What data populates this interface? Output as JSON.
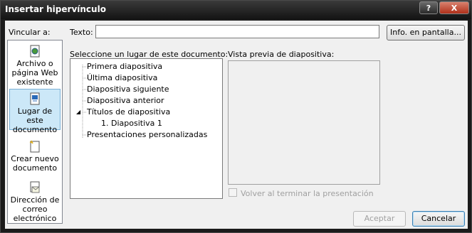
{
  "window": {
    "title": "Insertar hipervínculo",
    "help_btn": "?",
    "close_btn": "X"
  },
  "link_to": {
    "label": "Vincular a:",
    "items": [
      {
        "label": "Archivo o página Web existente",
        "icon": "file-web-icon"
      },
      {
        "label": "Lugar de este documento",
        "icon": "document-place-icon",
        "selected": true
      },
      {
        "label": "Crear nuevo documento",
        "icon": "new-document-icon"
      },
      {
        "label": "Dirección de correo electrónico",
        "icon": "email-icon"
      }
    ]
  },
  "text_field": {
    "label": "Texto:",
    "value": ""
  },
  "screentip_button": "Info. en pantalla...",
  "place_list": {
    "label": "Seleccione un lugar de este documento:",
    "items": [
      "Primera diapositiva",
      "Última diapositiva",
      "Diapositiva siguiente",
      "Diapositiva anterior",
      "Títulos de diapositiva",
      "1. Diapositiva 1",
      "Presentaciones personalizadas"
    ],
    "expander": "◢"
  },
  "preview": {
    "label": "Vista previa de diapositiva:"
  },
  "return_checkbox": {
    "label": "Volver al terminar la presentación",
    "checked": false,
    "enabled": false
  },
  "buttons": {
    "ok": "Aceptar",
    "cancel": "Cancelar"
  }
}
